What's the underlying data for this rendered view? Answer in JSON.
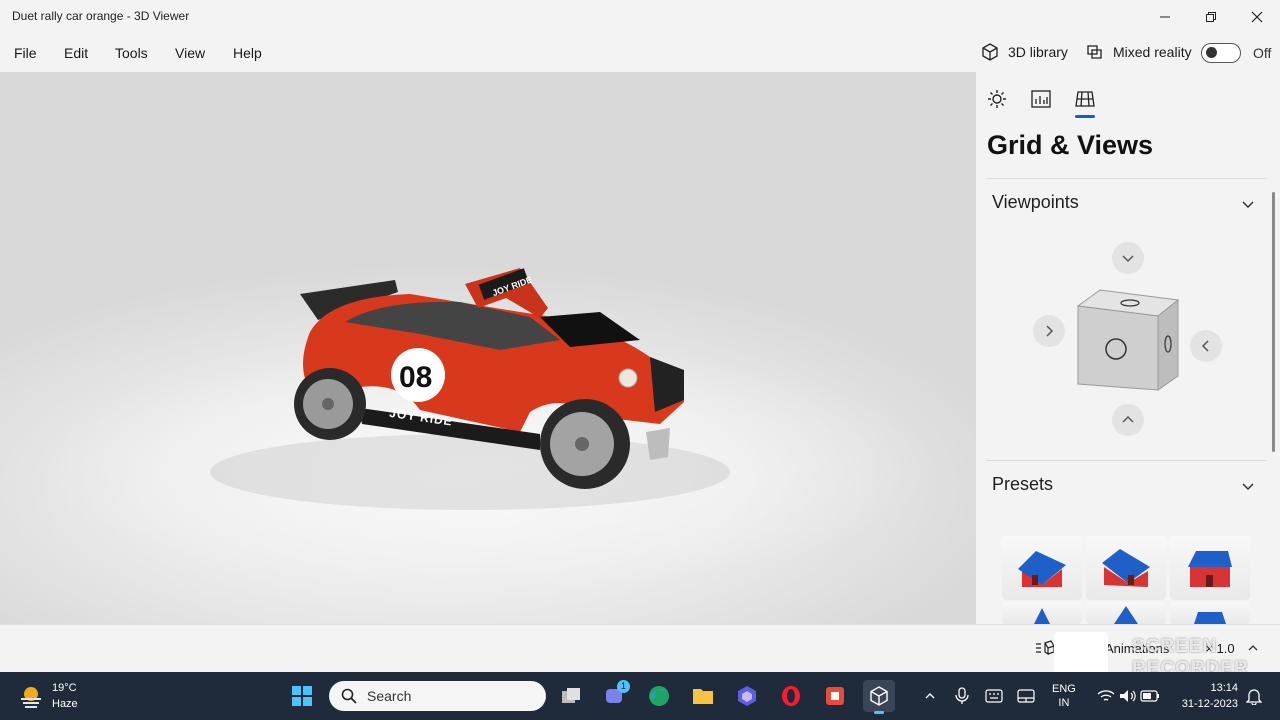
{
  "window": {
    "title": "Duet rally car orange - 3D Viewer"
  },
  "menu": {
    "items": [
      "File",
      "Edit",
      "Tools",
      "View",
      "Help"
    ]
  },
  "toolbar_right": {
    "library_label": "3D library",
    "mixed_reality_label": "Mixed reality",
    "toggle_state": "Off"
  },
  "model": {
    "number": "08",
    "brand_text": "JOY RIDE",
    "roof_text": "JOY RIDE",
    "color": "#d8391c"
  },
  "panel": {
    "tabs": [
      "lighting-icon",
      "stats-icon",
      "grid-icon"
    ],
    "active_tab": "grid-icon",
    "heading": "Grid & Views",
    "sections": {
      "viewpoints": "Viewpoints",
      "presets": "Presets"
    }
  },
  "bottom": {
    "animations_label": "Animations",
    "speed": "× 1.0",
    "watermark_line1": "SCREEN",
    "watermark_line2": "RECORDER"
  },
  "taskbar": {
    "weather_temp": "19°C",
    "weather_desc": "Haze",
    "search_placeholder": "Search",
    "lang_line1": "ENG",
    "lang_line2": "IN",
    "time": "13:14",
    "date": "31-12-2023",
    "badge": "1"
  }
}
